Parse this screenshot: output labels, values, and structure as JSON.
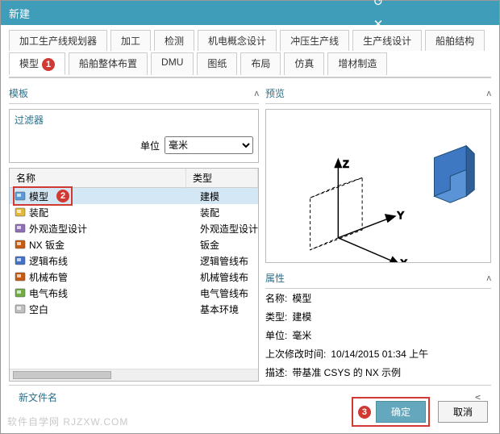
{
  "title": "新建",
  "tabs_row1": [
    "加工生产线规划器",
    "加工",
    "检测",
    "机电概念设计",
    "冲压生产线",
    "生产线设计",
    "船舶结构"
  ],
  "tabs_row2": [
    "模型",
    "船舶整体布置",
    "DMU",
    "图纸",
    "布局",
    "仿真",
    "增材制造"
  ],
  "active_tab": "模型",
  "step_badges": {
    "tab": "1",
    "row": "2",
    "ok": "3"
  },
  "left": {
    "section": "模板",
    "filter": {
      "title": "过滤器",
      "unit_label": "单位",
      "unit_value": "毫米"
    },
    "cols": {
      "name": "名称",
      "type": "类型"
    },
    "rows": [
      {
        "name": "模型",
        "type": "建模",
        "selected": true,
        "icon": "model"
      },
      {
        "name": "装配",
        "type": "装配",
        "icon": "assembly"
      },
      {
        "name": "外观造型设计",
        "type": "外观造型设计",
        "icon": "shape"
      },
      {
        "name": "NX 钣金",
        "type": "钣金",
        "icon": "sheetmetal"
      },
      {
        "name": "逻辑布线",
        "type": "逻辑管线布",
        "icon": "routing-l"
      },
      {
        "name": "机械布管",
        "type": "机械管线布",
        "icon": "routing-m"
      },
      {
        "name": "电气布线",
        "type": "电气管线布",
        "icon": "routing-e"
      },
      {
        "name": "空白",
        "type": "基本环境",
        "icon": "blank"
      }
    ]
  },
  "right": {
    "preview": "预览",
    "properties": "属性",
    "props": [
      {
        "k": "名称:",
        "v": "模型"
      },
      {
        "k": "类型:",
        "v": "建模"
      },
      {
        "k": "单位:",
        "v": "毫米"
      },
      {
        "k": "上次修改时间:",
        "v": "10/14/2015 01:34 上午"
      },
      {
        "k": "描述:",
        "v": "带基准 CSYS 的 NX 示例"
      }
    ]
  },
  "new_file_section": "新文件名",
  "buttons": {
    "ok": "确定",
    "cancel": "取消"
  },
  "watermark": "软件自学网 RJZXW.COM"
}
